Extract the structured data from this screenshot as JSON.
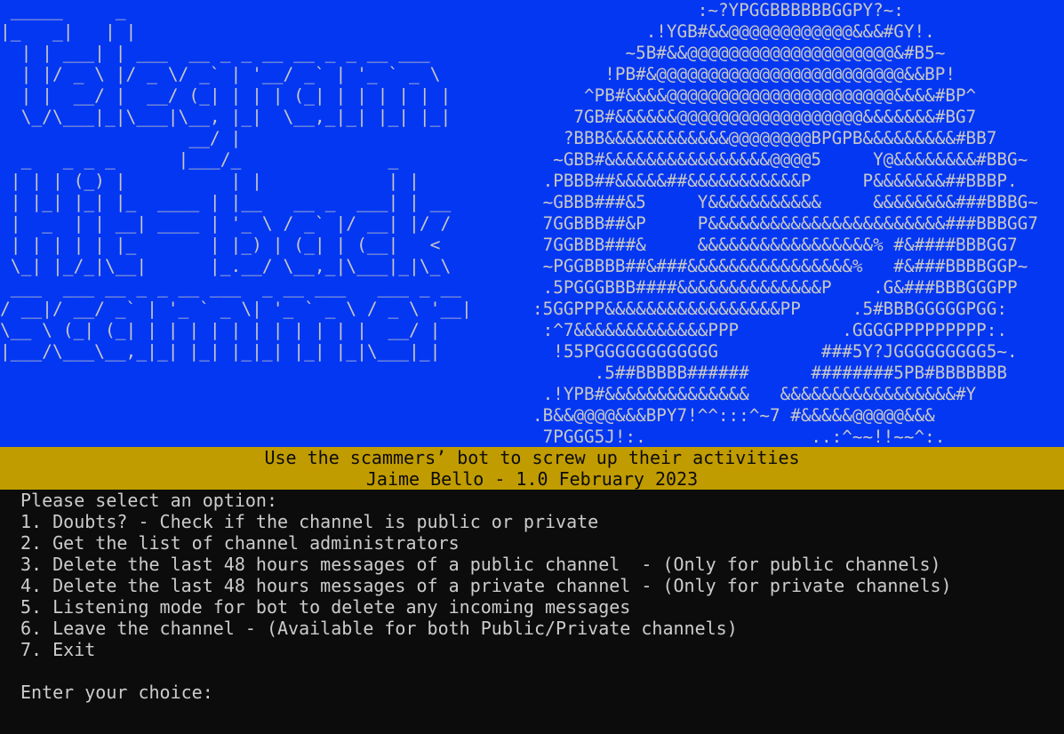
{
  "terminal": {
    "ascii_art_left": " _____     _\n|_   _|   | |\n  | | ___| | ___  __ _ _ __ __ _ _ __ ___\n  | |/ _ \\ |/ _ \\/ _` | '__/ _` | '_ ` _ \\\n  | |  __/ |  __/ (_| | | | (_| | | | | | |\n  \\_/\\___|_|\\___|\\__, |_|  \\__,_|_| |_| |_|\n                  __/ |\n  _   _ _ _      |___/_              _\n | | | (_) |          | |            | |\n | |_| |_| |_  ____ | |__   __ _  ___| | __\n |  _  | | __| ____ | '_ \\ / _` |/ __| |/ /\n | | | | | |_       | |_) | (_| | (__|   <\n \\_| |_/_|\\__|      |_.__/ \\__,_|\\___|_|\\_\\\n ___  ___ __ _ _ __ ___  _ __ ___   ___ _ __\n/ __|/ __/ _` | '_ ` _ \\| '_ ` _ \\ / _ \\ '__|\n\\__ \\ (_| (_| | | | | | | | | | | |  __/ |\n|___/\\___\\__,_|_| |_| |_|_| |_| |_|\\___|_|",
    "ascii_art_right": "                :~?YPGGBBBBBBGGPY?~:\n           .!YGB#&&@@@@@@@@@@@@&&&#GY!.\n         ~5B#&&@@@@@@@@@@@@@@@@@@@@&#B5~\n       !PB#&@@@@@@@@@@@@@@@@@@@@@@@@&&BP!\n     ^PB#&&&&@@@@@@@@@@@@@@@@@@@@@@&&&&#BP^\n    7GB#&&&&&&@@@@@@@@@@@@@@@@@@&&&&&&&#BG7\n   ?BBB&&&&&&&&&&&&@@@@@@@@BPGPB&&&&&&&&&#BB7\n  ~GBB#&&&&&&&&&&&&&&&&@@@@5     Y@&&&&&&&&#BBG~\n .PBBB##&&&&&##&&&&&&&&&&&P     P&&&&&&&##BBBP.\n ~GBBB###&5     Y&&&&&&&&&&&     &&&&&&&&###BBBG~\n 7GGBBB##&P     P&&&&&&&&&&&&&&&&&&&&&&&###BBBGG7\n 7GGBBB###&     &&&&&&&&&&&&&&&&&% #&####BBBGG7\n ~PGGBBBB##&###&&&&&&&&&&&&&&&&%   #&###BBBBGGP~\n .5PGGGBBB####&&&&&&&&&&&&&&P    .G&###BBBGGGPP\n:5GGPPP&&&&&&&&&&&&&&&&&PP     .5#BBBGGGGGPGG:\n :^7&&&&&&&&&&&&&PPP          .GGGGPPPPPPPPP:.\n  !55PGGGGGGGGGGGG          ###5Y?JGGGGGGGGG5~.\n      .5##BBBBB######      ########5PB#BBBBBBB\n .!YPB#&&&&&&&&&&&&&&   &&&&&&&&&&&&&&&&&#Y\n.B&&@@@@&&&BPY7!^^:::^~7 #&&&&&@@@@@&&&\n 7PGGG5J!:.                ..:^~~!!~~^:."
  },
  "header": {
    "tagline": "Use the scammers’ bot to screw up their activities",
    "author_version": "Jaime Bello - 1.0 February 2023"
  },
  "menu": {
    "heading": "Please select an option:",
    "options": [
      "1. Doubts? - Check if the channel is public or private",
      "2. Get the list of channel administrators",
      "3. Delete the last 48 hours messages of a public channel  - (Only for public channels)",
      "4. Delete the last 48 hours messages of a private channel - (Only for private channels)",
      "5. Listening mode for bot to delete any incoming messages",
      "6. Leave the channel - (Available for both Public/Private channels)",
      "7. Exit"
    ],
    "prompt": "Enter your choice:"
  },
  "colors": {
    "banner_background": "#0437f2",
    "subtitle_background": "#c19c00",
    "terminal_background": "#0c0c0c",
    "terminal_text": "#cccccc"
  }
}
